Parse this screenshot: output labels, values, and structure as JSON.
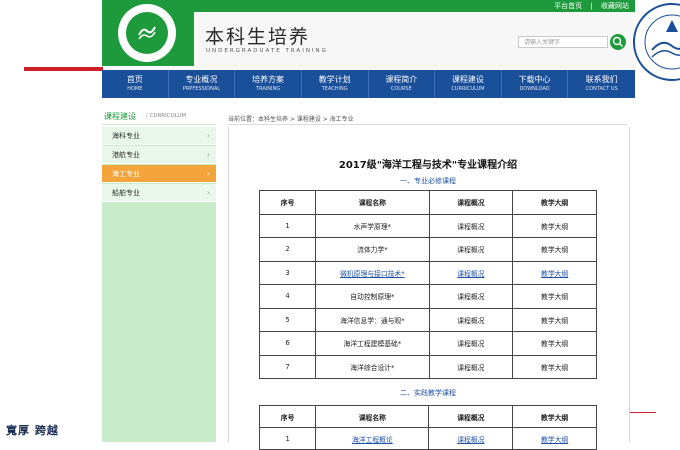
{
  "top_links": [
    "平台首页",
    "收藏网站"
  ],
  "header": {
    "title": "本科生培养",
    "subtitle": "UNDERGRADUATE TRAINING",
    "search_placeholder": "请输入关键字"
  },
  "nav": [
    {
      "zh": "首页",
      "en": "HOME"
    },
    {
      "zh": "专业概况",
      "en": "PRPFESSIONAL"
    },
    {
      "zh": "培养方案",
      "en": "TRAINING"
    },
    {
      "zh": "教学计划",
      "en": "TEACHING"
    },
    {
      "zh": "课程简介",
      "en": "COURSE"
    },
    {
      "zh": "课程建设",
      "en": "CURRICULUM"
    },
    {
      "zh": "下载中心",
      "en": "DOWNLOAD"
    },
    {
      "zh": "联系我们",
      "en": "CONTACT US"
    }
  ],
  "sidebar": {
    "heading_zh": "课程建设",
    "heading_en": "/ CURRICULUM",
    "items": [
      {
        "label": "海科专业",
        "active": false
      },
      {
        "label": "港航专业",
        "active": false
      },
      {
        "label": "海工专业",
        "active": true
      },
      {
        "label": "船舶专业",
        "active": false
      }
    ]
  },
  "breadcrumb": "当前位置：本科生培养 > 课程建设 > 海工专业",
  "doc": {
    "title": "2017级\"海洋工程与技术\"专业课程介绍",
    "section1": "一、专业必修课程",
    "section2": "二、实践教学课程",
    "table_headers": [
      "序号",
      "课程名称",
      "课程概况",
      "教学大纲"
    ],
    "table1": [
      {
        "no": "1",
        "name": "水声学原理*",
        "overview": "课程概况",
        "syllabus": "教学大纲",
        "link": false
      },
      {
        "no": "2",
        "name": "流体力学*",
        "overview": "课程概况",
        "syllabus": "教学大纲",
        "link": false
      },
      {
        "no": "3",
        "name": "微机原理与接口技术*",
        "overview": "课程概况",
        "syllabus": "教学大纲",
        "link": true
      },
      {
        "no": "4",
        "name": "自动控制原理*",
        "overview": "课程概况",
        "syllabus": "教学大纲",
        "link": false
      },
      {
        "no": "5",
        "name": "海洋信息学：通与观*",
        "overview": "课程概况",
        "syllabus": "教学大纲",
        "link": false
      },
      {
        "no": "6",
        "name": "海洋工程建模基础*",
        "overview": "课程概况",
        "syllabus": "教学大纲",
        "link": false
      },
      {
        "no": "7",
        "name": "海洋综合设计*",
        "overview": "课程概况",
        "syllabus": "教学大纲",
        "link": false
      }
    ],
    "table2": [
      {
        "no": "1",
        "name": "海洋工程概论",
        "overview": "课程概况",
        "syllabus": "教学大纲",
        "link": true
      }
    ]
  },
  "footer_calligraphy": "寬厚 跨越",
  "colors": {
    "green": "#1c9a3c",
    "nav_blue": "#1a4f9a",
    "active_orange": "#f3a43b",
    "red": "#cc1f28"
  }
}
